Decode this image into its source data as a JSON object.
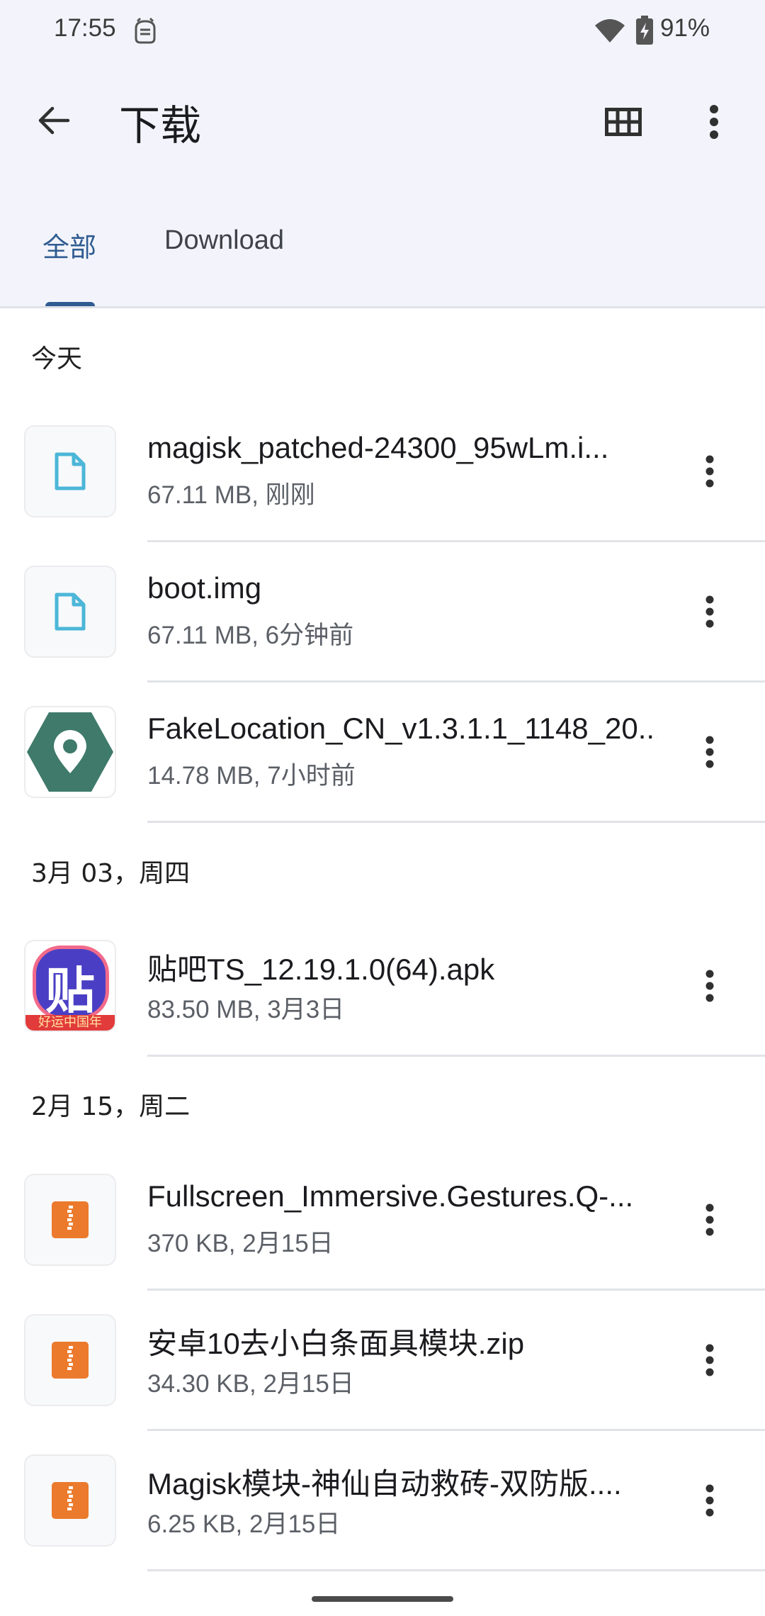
{
  "status_bar": {
    "time": "17:55",
    "battery": "91%"
  },
  "app_bar": {
    "title": "下载",
    "back_icon": "arrow-back-icon",
    "grid_icon": "grid-view-icon",
    "more_icon": "more-vert-icon"
  },
  "tabs": [
    {
      "label": "全部",
      "selected": true
    },
    {
      "label": "Download",
      "selected": false
    }
  ],
  "sections": [
    {
      "header": "今天",
      "files": [
        {
          "name": "magisk_patched-24300_95wLm.i...",
          "meta": "67.11 MB, 刚刚",
          "icon": "document-file-icon"
        },
        {
          "name": "boot.img",
          "meta": "67.11 MB, 6分钟前",
          "icon": "document-file-icon"
        },
        {
          "name": "FakeLocation_CN_v1.3.1.1_1148_20...",
          "meta": "14.78 MB, 7小时前",
          "icon": "fakelocation-app-icon"
        }
      ]
    },
    {
      "header": "3月 03，周四",
      "files": [
        {
          "name": "贴吧TS_12.19.1.0(64).apk",
          "meta": "83.50 MB, 3月3日",
          "icon": "tieba-app-icon",
          "icon_text": "贴",
          "icon_banner": "好运中国年"
        }
      ]
    },
    {
      "header": "2月 15，周二",
      "files": [
        {
          "name": "Fullscreen_Immersive.Gestures.Q-...",
          "meta": "370 KB, 2月15日",
          "icon": "zip-archive-icon"
        },
        {
          "name": "安卓10去小白条面具模块.zip",
          "meta": "34.30 KB, 2月15日",
          "icon": "zip-archive-icon"
        },
        {
          "name": "Magisk模块-神仙自动救砖-双防版....",
          "meta": "6.25 KB, 2月15日",
          "icon": "zip-archive-icon"
        }
      ]
    }
  ],
  "colors": {
    "accent": "#2f5c91",
    "header_bg": "#f3f4fb",
    "doc_icon": "#4cb6d8",
    "zip_icon": "#ec7a2c",
    "fakelocation_green": "#3f7a6a"
  }
}
